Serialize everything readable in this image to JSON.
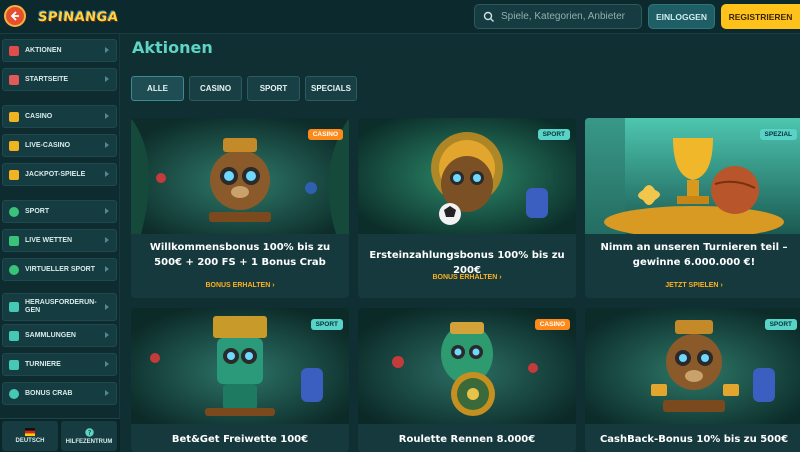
{
  "header": {
    "logo": "SPINANGA",
    "search_placeholder": "Spiele, Kategorien, Anbieter",
    "login": "EINLOGGEN",
    "register": "REGISTRIEREN"
  },
  "sidebar": {
    "items": [
      {
        "label": "AKTIONEN",
        "icon": "gift-icon",
        "color": "#e04b4b"
      },
      {
        "label": "STARTSEITE",
        "icon": "home-icon",
        "color": "#e05a5a"
      },
      {
        "label": "CASINO",
        "icon": "slot-icon",
        "color": "#f0b423"
      },
      {
        "label": "LIVE-CASINO",
        "icon": "bell-icon",
        "color": "#f0b423"
      },
      {
        "label": "JACKPOT-SPIELE",
        "icon": "jackpot-icon",
        "color": "#f0b423"
      },
      {
        "label": "SPORT",
        "icon": "soccer-icon",
        "color": "#3bc27a"
      },
      {
        "label": "LIVE WETTEN",
        "icon": "live-icon",
        "color": "#3bc27a"
      },
      {
        "label": "VIRTUELLER SPORT",
        "icon": "virtual-sport-icon",
        "color": "#3bc27a"
      },
      {
        "label": "HERAUSFORDERUN-GEN",
        "icon": "challenge-icon",
        "color": "#45c9b5"
      },
      {
        "label": "SAMMLUNGEN",
        "icon": "collection-icon",
        "color": "#45c9b5"
      },
      {
        "label": "TURNIERE",
        "icon": "trophy-icon",
        "color": "#45c9b5"
      },
      {
        "label": "BONUS CRAB",
        "icon": "crab-icon",
        "color": "#45c9b5"
      }
    ],
    "language": "DEUTSCH",
    "help": "HILFEZENTRUM"
  },
  "main": {
    "title": "Aktionen",
    "filters": [
      "ALLE",
      "CASINO",
      "SPORT",
      "SPECIALS"
    ],
    "cards": [
      {
        "tag": "CASINO",
        "title": "Willkommensbonus 100% bis zu 500€ + 200 FS + 1 Bonus Crab",
        "cta": "BONUS ERHALTEN"
      },
      {
        "tag": "SPORT",
        "title": "Ersteinzahlungsbonus 100% bis zu 200€",
        "cta": "BONUS ERHALTEN"
      },
      {
        "tag": "SPEZIAL",
        "title": "Nimm an unseren Turnieren teil – gewinne 6.000.000 €!",
        "cta": "JETZT SPIELEN"
      },
      {
        "tag": "SPORT",
        "title": "Bet&Get Freiwette 100€",
        "cta": ""
      },
      {
        "tag": "CASINO",
        "title": "Roulette Rennen 8.000€",
        "cta": ""
      },
      {
        "tag": "SPORT",
        "title": "CashBack-Bonus 10% bis zu 500€",
        "cta": ""
      }
    ]
  }
}
